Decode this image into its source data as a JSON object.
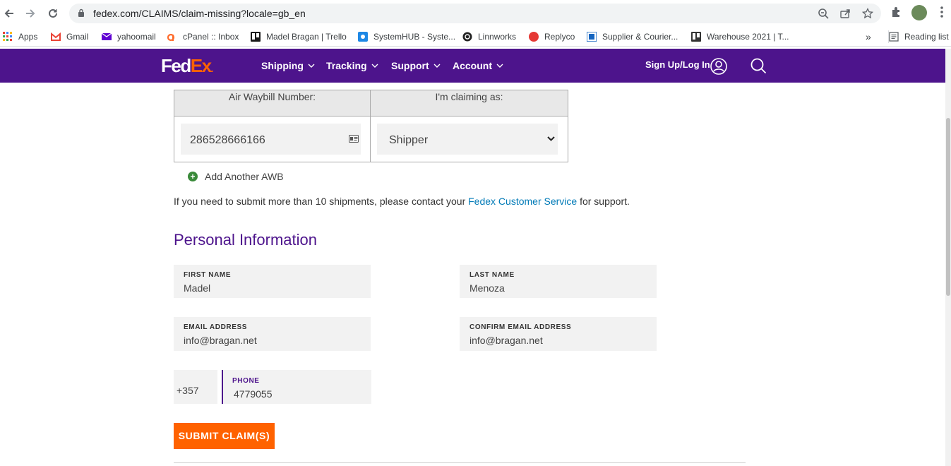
{
  "browser": {
    "url": "fedex.com/CLAIMS/claim-missing?locale=gb_en",
    "bookmarks": [
      {
        "label": "Apps",
        "color": "#ea4335"
      },
      {
        "label": "Gmail",
        "color": "#ea4335"
      },
      {
        "label": "yahoomail",
        "color": "#6001d2"
      },
      {
        "label": "cPanel :: Inbox",
        "color": "#ff6c2c"
      },
      {
        "label": "Madel Bragan | Trello",
        "color": "#1a1a1a"
      },
      {
        "label": "SystemHUB - Syste...",
        "color": "#1e88e5"
      },
      {
        "label": "Linnworks",
        "color": "#222222"
      },
      {
        "label": "Replyco",
        "color": "#e53935"
      },
      {
        "label": "Supplier & Courier...",
        "color": "#1565c0"
      },
      {
        "label": "Warehouse 2021 | T...",
        "color": "#333333"
      }
    ],
    "more": "»",
    "reading_list": "Reading list"
  },
  "header": {
    "logo_fed": "Fed",
    "logo_ex": "Ex",
    "logo_dot": ".",
    "nav": [
      "Shipping",
      "Tracking",
      "Support",
      "Account"
    ],
    "signin": "Sign Up/Log In",
    "brand_color": "#4d148c",
    "accent_color": "#ff6200"
  },
  "awb": {
    "col1_header": "Air Waybill Number:",
    "col2_header": "I'm claiming as:",
    "number": "286528666166",
    "claiming_as": "Shipper",
    "add_another": "Add Another AWB"
  },
  "notice": {
    "before": "If you need to submit more than 10 shipments, please contact your ",
    "link": "Fedex Customer Service",
    "after": " for support."
  },
  "personal": {
    "title": "Personal Information",
    "first_name_label": "FIRST NAME",
    "first_name": "Madel",
    "last_name_label": "LAST NAME",
    "last_name": "Menoza",
    "email_label": "EMAIL ADDRESS",
    "email": "info@bragan.net",
    "confirm_email_label": "CONFIRM EMAIL ADDRESS",
    "confirm_email": "info@bragan.net",
    "country_code": "+357",
    "phone_label": "PHONE",
    "phone": "4779055"
  },
  "submit_label": "SUBMIT CLAIM(S)"
}
